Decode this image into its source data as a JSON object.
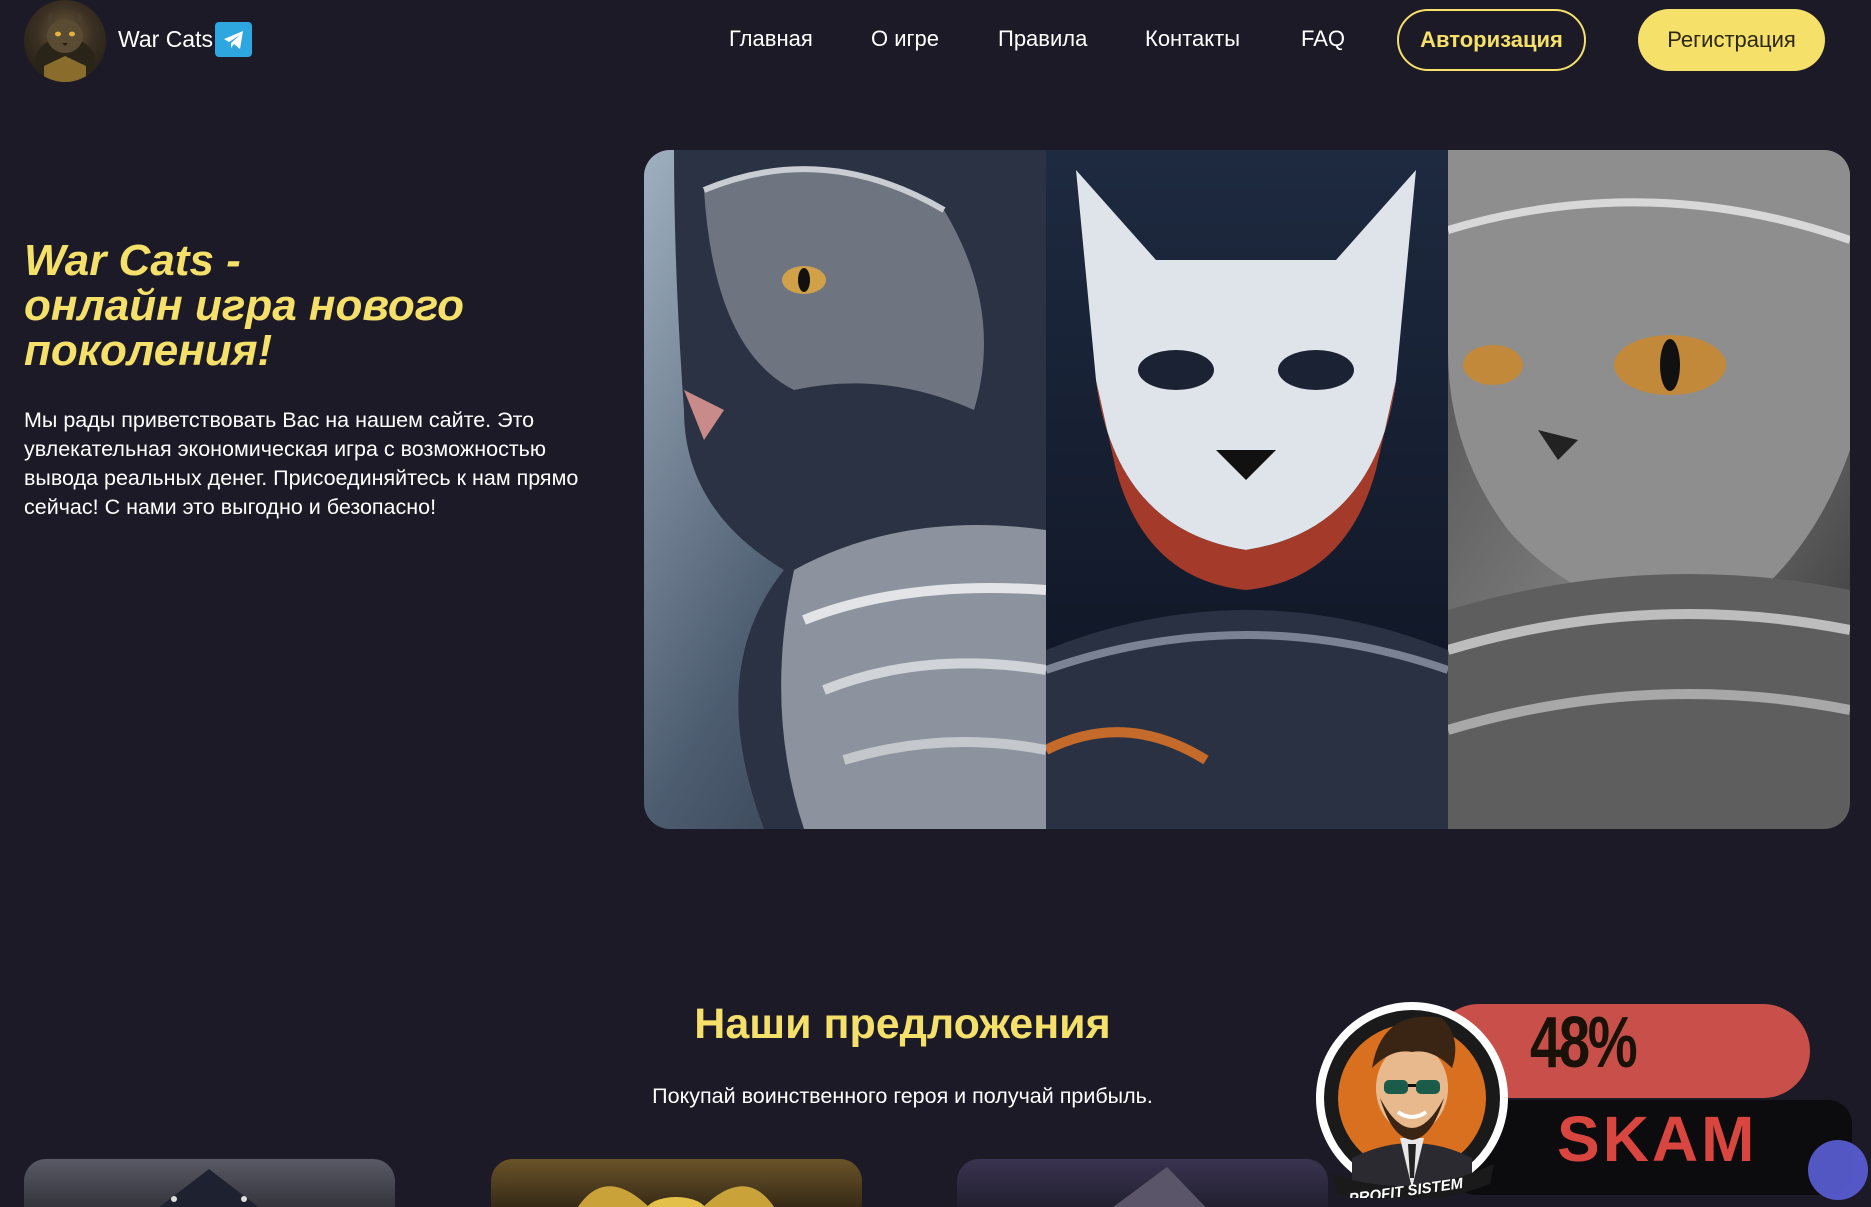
{
  "header": {
    "brand": "War Cats",
    "nav": [
      "Главная",
      "О игре",
      "Правила",
      "Контакты",
      "FAQ"
    ],
    "login_label": "Авторизация",
    "register_label": "Регистрация"
  },
  "hero": {
    "title_line1": "War Cats -",
    "title_line2": "онлайн игра нового",
    "title_line3": "поколения!",
    "text": "Мы рады приветствовать Вас на нашем сайте. Это увлекательная экономическая игра с возможностью вывода реальных денег. Присоединяйтесь к нам прямо сейчас! С нами это выгодно и безопасно!"
  },
  "offers": {
    "title": "Наши предложения",
    "subtitle": "Покупай воинственного героя и получай прибыль."
  },
  "overlay": {
    "percent": "48%",
    "label": "SKAM",
    "seal_text": "PROFIT SISTEM"
  },
  "colors": {
    "background": "#1c1a26",
    "accent": "#f5e06a",
    "telegram": "#2ea6e0",
    "badge_red": "#c9504a"
  },
  "icons": [
    "telegram-icon",
    "cat-avatar-logo"
  ]
}
